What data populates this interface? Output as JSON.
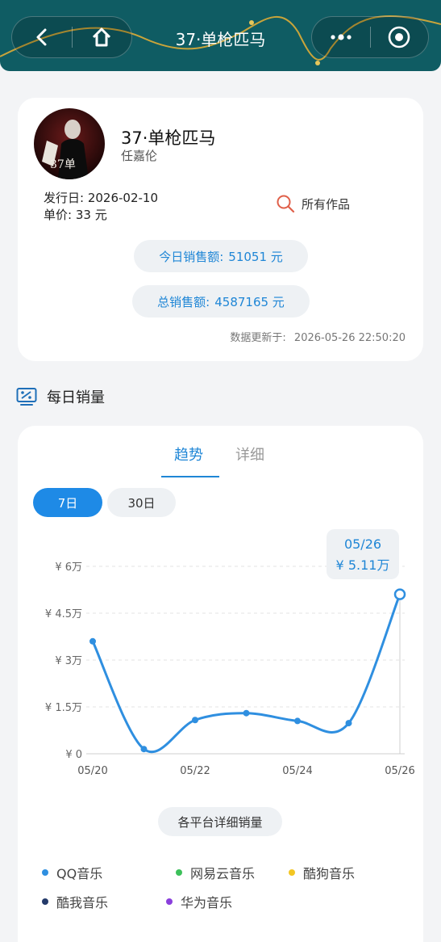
{
  "header": {
    "title": "37·单枪匹马",
    "back_icon": "back-arrow-icon",
    "home_icon": "home-icon",
    "more_icon": "more-dots-icon",
    "target_icon": "target-icon"
  },
  "song": {
    "title": "37·单枪匹马",
    "artist": "任嘉伦",
    "release_label": "发行日:",
    "release_date": "2026-02-10",
    "price_label": "单价:",
    "price_value": "33 元",
    "all_works": "所有作品",
    "today_label": "今日销售额:",
    "today_value": "51051 元",
    "total_label": "总销售额:",
    "total_value": "4587165 元",
    "updated_label": "数据更新于:",
    "updated_value": "2026-05-26 22:50:20"
  },
  "section": {
    "title": "每日销量"
  },
  "tabs": [
    {
      "label": "趋势"
    },
    {
      "label": "详细"
    }
  ],
  "ranges": [
    {
      "label": "7日"
    },
    {
      "label": "30日"
    }
  ],
  "tooltip": {
    "date": "05/26",
    "value": "¥ 5.11万"
  },
  "detail_button": "各平台详细销量",
  "legend": [
    {
      "label": "QQ音乐",
      "color": "#2f8fe0"
    },
    {
      "label": "网易云音乐",
      "color": "#3cc05a"
    },
    {
      "label": "酷狗音乐",
      "color": "#f3c623"
    },
    {
      "label": "酷我音乐",
      "color": "#243a6a"
    },
    {
      "label": "华为音乐",
      "color": "#8a3fdc"
    }
  ],
  "chart_data": {
    "type": "line",
    "x": [
      "05/20",
      "05/21",
      "05/22",
      "05/23",
      "05/24",
      "05/25",
      "05/26"
    ],
    "x_tick_labels": [
      "05/20",
      "05/22",
      "05/24",
      "05/26"
    ],
    "y_tick_labels": [
      "¥ 0",
      "¥ 1.5万",
      "¥ 3万",
      "¥ 4.5万",
      "¥ 6万"
    ],
    "series": [
      {
        "values": [
          36000,
          1500,
          10800,
          13000,
          10500,
          9800,
          51051
        ]
      }
    ],
    "ylim": [
      0,
      60000
    ],
    "grid": true
  }
}
